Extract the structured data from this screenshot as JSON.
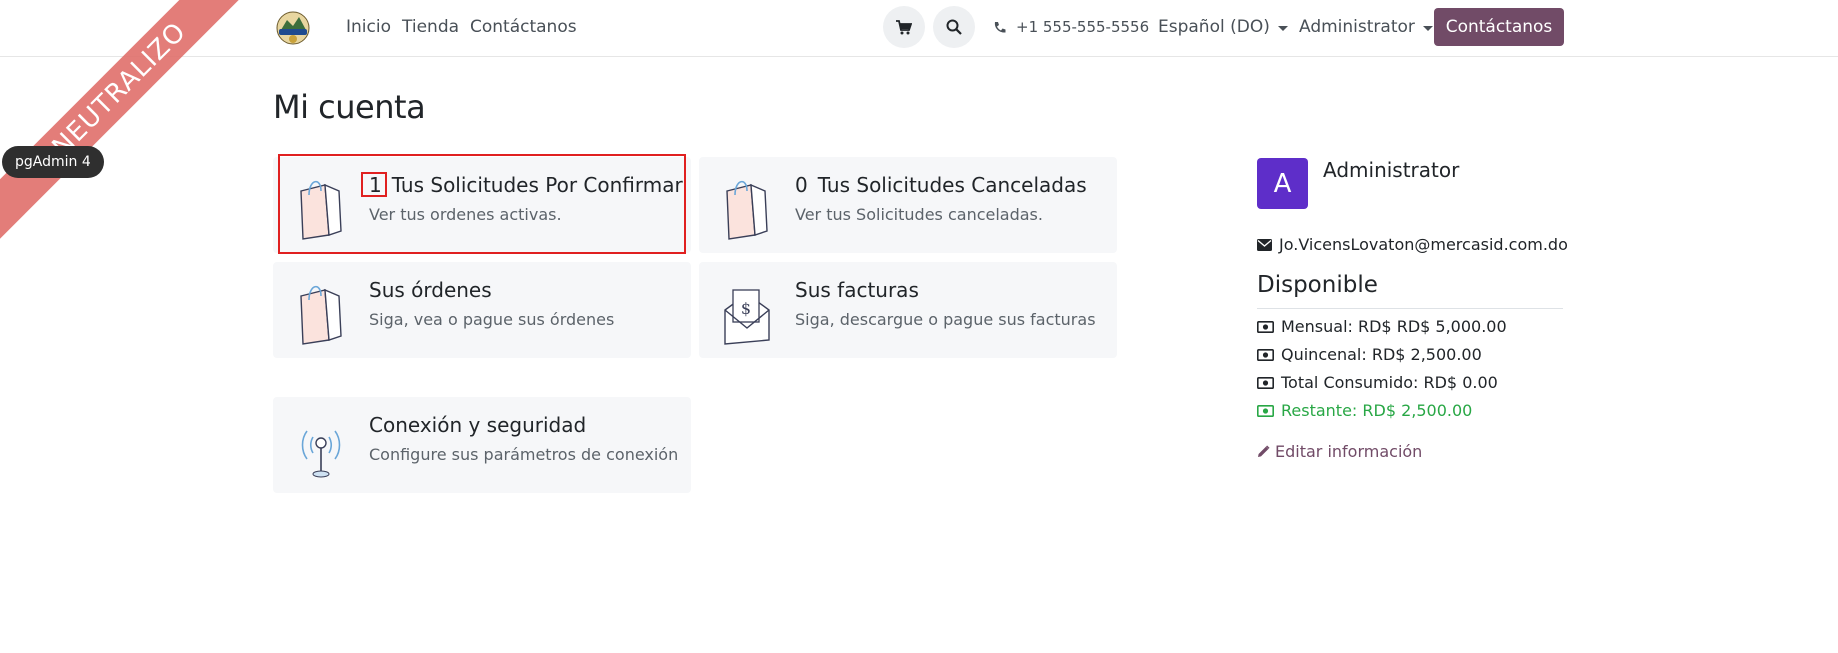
{
  "ribbon": {
    "text": "E NEUTRALIZO"
  },
  "overlay": {
    "pgadmin_label": "pgAdmin 4"
  },
  "header": {
    "nav": [
      "Inicio",
      "Tienda",
      "Contáctanos"
    ],
    "phone": "+1 555-555-5556",
    "language": "Español (DO)",
    "user": "Administrator",
    "cta": "Contáctanos",
    "icons": {
      "cart": "cart-icon",
      "search": "search-icon",
      "phone": "phone-icon"
    }
  },
  "page": {
    "title": "Mi cuenta"
  },
  "cards": [
    {
      "count": "1",
      "title": "Tus Solicitudes Por Confirmar",
      "subtitle": "Ver tus ordenes activas.",
      "icon": "shopping-bag-icon"
    },
    {
      "count": "0",
      "title": "Tus Solicitudes Canceladas",
      "subtitle": "Ver tus Solicitudes canceladas.",
      "icon": "shopping-bag-icon"
    },
    {
      "title": "Sus órdenes",
      "subtitle": "Siga, vea o pague sus órdenes",
      "icon": "shopping-bag-icon"
    },
    {
      "title": "Sus facturas",
      "subtitle": "Siga, descargue o pague sus facturas",
      "icon": "invoice-envelope-icon"
    },
    {
      "title": "Conexión y seguridad",
      "subtitle": "Configure sus parámetros de conexión",
      "icon": "antenna-icon"
    }
  ],
  "sidebar": {
    "avatar_letter": "A",
    "name": "Administrator",
    "email": "Jo.VicensLovaton@mercasid.com.do",
    "section_title": "Disponible",
    "balances": [
      {
        "text": "Mensual: RD$ RD$ 5,000.00",
        "color": "#212529"
      },
      {
        "text": "Quincenal: RD$ 2,500.00",
        "color": "#212529"
      },
      {
        "text": "Total Consumido: RD$ 0.00",
        "color": "#212529"
      },
      {
        "text": "Restante: RD$ 2,500.00",
        "color": "#28a745"
      }
    ],
    "edit_label": "Editar información"
  },
  "colors": {
    "brand": "#714b67",
    "avatar": "#5e2ec9",
    "highlight": "#e02020",
    "success": "#28a745"
  }
}
